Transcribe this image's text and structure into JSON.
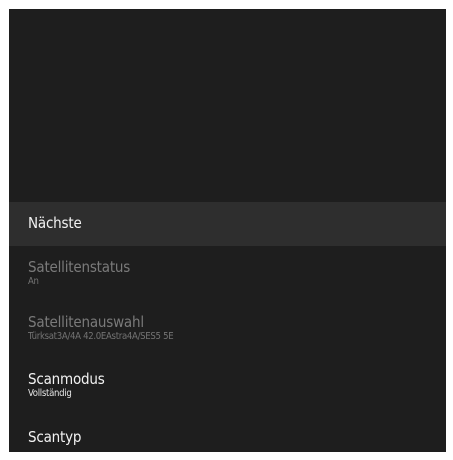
{
  "menu": {
    "items": [
      {
        "label": "Nächste",
        "sublabel": ""
      },
      {
        "label": "Satellitenstatus",
        "sublabel": "An"
      },
      {
        "label": "Satellitenauswahl",
        "sublabel": "Türksat3A/4A 42.0EAstra4A/SES5 5E"
      },
      {
        "label": "Scanmodus",
        "sublabel": "Vollständig"
      },
      {
        "label": "Scantyp",
        "sublabel": ""
      }
    ],
    "colors": {
      "panel_background": "#1e1e1e",
      "focused_background": "#2e2e2e",
      "active_text": "#f2f2f2",
      "disabled_text": "#7a7a7a"
    }
  }
}
